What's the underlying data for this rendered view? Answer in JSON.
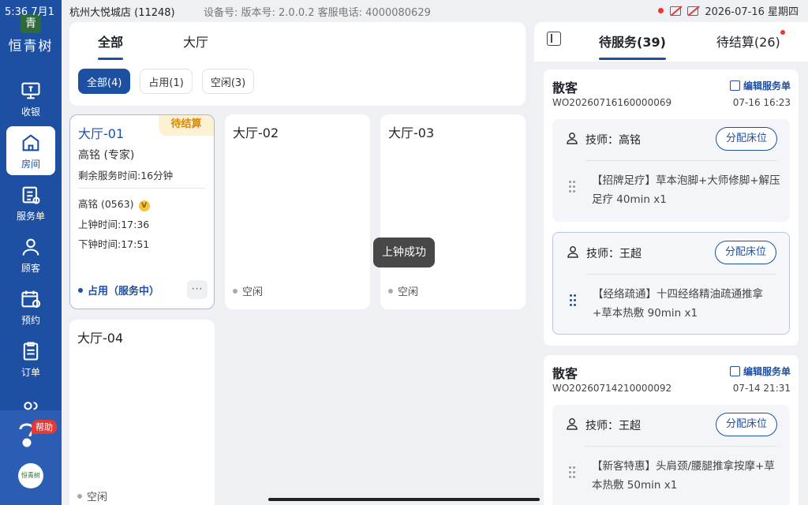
{
  "statusbar": {
    "time": "5:36  7月1",
    "store": "杭州大悦城店    (11248)",
    "device": "设备号:  版本号: 2.0.0.2  客服电话: 4000080629",
    "datetime": "2026-07-16 星期四"
  },
  "sidebar": {
    "logo_text": "青",
    "brand_name": "恒青树",
    "items": [
      {
        "label": "收银",
        "icon": "cashier-icon"
      },
      {
        "label": "房间",
        "icon": "home-icon"
      },
      {
        "label": "服务单",
        "icon": "service-list-icon"
      },
      {
        "label": "顾客",
        "icon": "user-icon"
      },
      {
        "label": "预约",
        "icon": "calendar-icon"
      },
      {
        "label": "订单",
        "icon": "order-icon"
      },
      {
        "label": "",
        "icon": "users-icon"
      }
    ],
    "help_label": "帮助",
    "avatar_text": "恒青树"
  },
  "filters": {
    "tabs": [
      "全部",
      "大厅"
    ],
    "active_tab": 0,
    "chips": [
      "全部(4)",
      "占用(1)",
      "空闲(3)"
    ],
    "active_chip": 0
  },
  "rooms": [
    {
      "name": "大厅-01",
      "ribbon": "待结算",
      "tech": "高铭 (专家)",
      "remaining": "剩余服务时间:16分钟",
      "tech_code": "高铭 (0563)",
      "vip_badge": "V",
      "start": "上钟时间:17:36",
      "end": "下钟时间:17:51",
      "status": "占用（服务中）",
      "more": "···"
    },
    {
      "name": "大厅-02",
      "status": "空闲"
    },
    {
      "name": "大厅-03",
      "status": "空闲"
    },
    {
      "name": "大厅-04",
      "status": "空闲"
    }
  ],
  "toast": "上钟成功",
  "right_panel": {
    "tabs": [
      "待服务(39)",
      "待结算(26)"
    ],
    "active_tab": 0,
    "orders": [
      {
        "customer": "散客",
        "edit_label": "编辑服务单",
        "order_no": "WO20260716160000069",
        "time": "07-16 16:23",
        "services": [
          {
            "tech": "技师：高铭",
            "assign": "分配床位",
            "item": "【招牌足疗】草本泡脚+大师修脚+解压足疗 40min x1"
          },
          {
            "tech": "技师：王超",
            "assign": "分配床位",
            "item": "【经络疏通】十四经络精油疏通推拿+草本热敷 90min x1"
          }
        ]
      },
      {
        "customer": "散客",
        "edit_label": "编辑服务单",
        "order_no": "WO20260714210000092",
        "time": "07-14 21:31",
        "services": [
          {
            "tech": "技师：王超",
            "assign": "分配床位",
            "item": "【新客特惠】头肩颈/腰腿推拿按摩+草本热敷 50min x1"
          }
        ]
      }
    ]
  },
  "colors": {
    "primary": "#1d4fa3",
    "ribbon_bg": "#fdf1d3",
    "ribbon_text": "#d88a00",
    "page_bg": "#eef0f4"
  }
}
